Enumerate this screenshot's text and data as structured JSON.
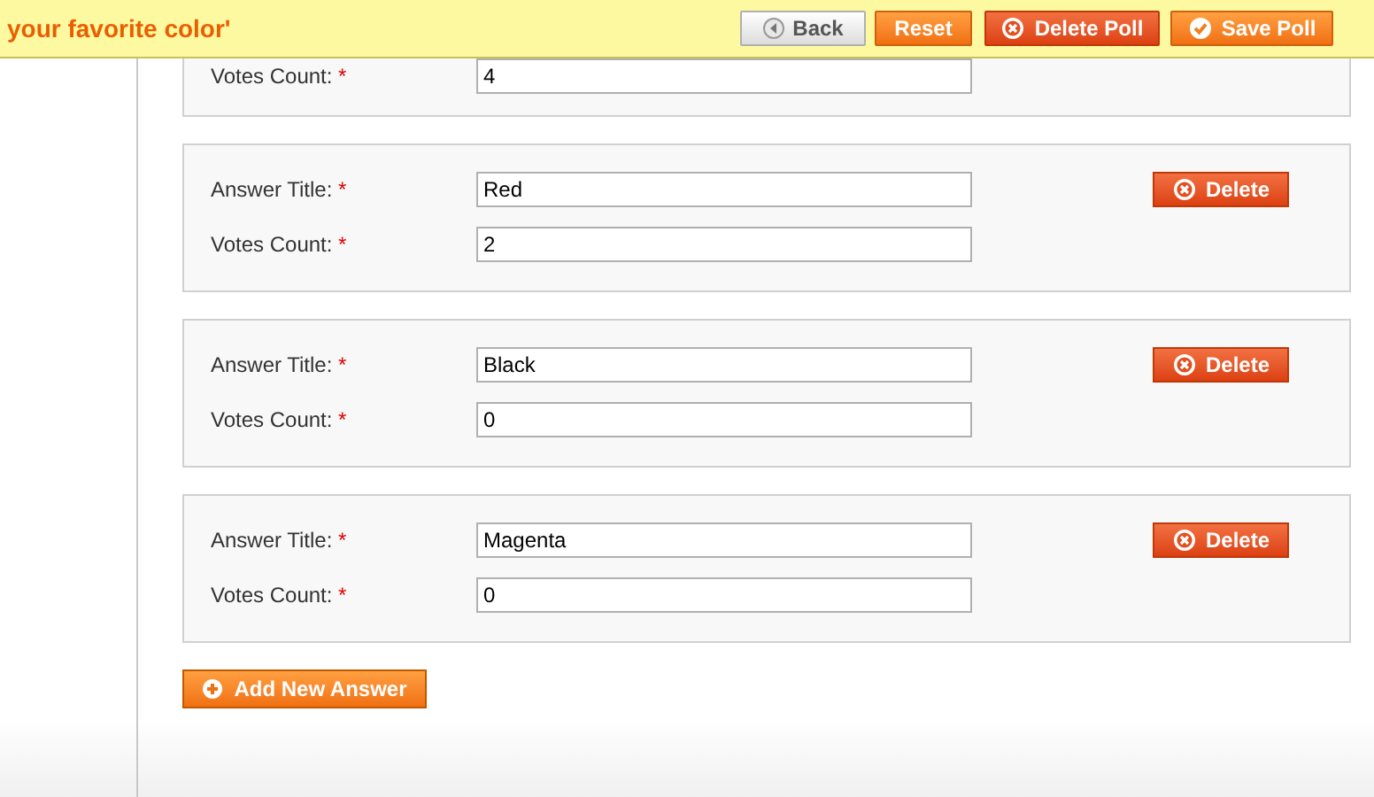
{
  "header": {
    "title": "your favorite color'",
    "buttons": [
      {
        "label": "Back",
        "kind": "back"
      },
      {
        "label": "Reset",
        "kind": "reset"
      },
      {
        "label": "Delete Poll",
        "kind": "delete"
      },
      {
        "label": "Save Poll",
        "kind": "save"
      }
    ]
  },
  "answers": [
    {
      "votes_label": "Votes Count:",
      "votes_mark": "*",
      "votes_value": "4"
    },
    {
      "title_label": "Answer Title:",
      "title_mark": "*",
      "title_value": "Red",
      "votes_label": "Votes Count:",
      "votes_mark": "*",
      "votes_value": "2",
      "delete_label": "Delete"
    },
    {
      "title_label": "Answer Title:",
      "title_mark": "*",
      "title_value": "Black",
      "votes_label": "Votes Count:",
      "votes_mark": "*",
      "votes_value": "0",
      "delete_label": "Delete"
    },
    {
      "title_label": "Answer Title:",
      "title_mark": "*",
      "title_value": "Magenta",
      "votes_label": "Votes Count:",
      "votes_mark": "*",
      "votes_value": "0",
      "delete_label": "Delete"
    }
  ],
  "add_button": {
    "label": "Add New Answer"
  }
}
